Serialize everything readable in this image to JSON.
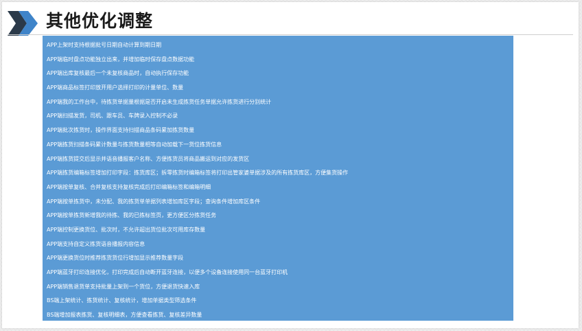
{
  "page": {
    "title": "其他优化调整"
  },
  "colors": {
    "content_background": "#5b9bd5",
    "header_chevron_dark": "#2b3a4a",
    "header_chevron_light": "#3f84c9"
  },
  "items": [
    "APP上架时支持根据批号日期自动计算到期日期",
    "APP端临时盘点功能独立出来，并增加临时保存盘点数据功能",
    "APP端出库复核最后一个未复核商品时，自动执行保存功能",
    "APP端商品标签打印放开用户选择打印的计量单位、数量",
    "APP端我的工作台中，待拣货单据量根据是否开启未生成拣货任务单据允许拣货进行分别统计",
    "APP端扫描发货，司机、跟车员、车牌录入控制不必录",
    "APP端批次拣货时，操作界面支持扫描商品条码累加拣货数量",
    "APP端拣货扫描条码累计数量与拣货数量相等自动加载下一货位拣货信息",
    "APP端拣货提交后显示并语音播报客户名称、方便拣货员将商品搬运到对应的发货区",
    "APP端拣货编箱标签增加打印字段：拣货库区；拆零拣货时编箱标签将打印出管家婆单据涉及的所有拣货库区，方便集货操作",
    "APP端按单复核、合并复核支持复核完成后打印编箱标签和编箱明细",
    "APP端按单拣货中，未分配、我的拣货单单据列表增加库区字段；查询条件增加库区条件",
    "APP端按单拣货新增我的待拣、我的已拣标签页，更方便区分拣货任务",
    "APP端控制更换货位、批次时，不允许超出货位批次可用库存数量",
    "APP端支持自定义拣货语音播报内容信息",
    "APP端更换货位时推荐拣货货位行增加显示推荐数量字段",
    "APP端蓝牙打印连接优化，打印完成后自动断开蓝牙连接，以便多个设备连接使用同一台蓝牙打印机",
    "APP端销售退货单支持批量上架到一个货位，方便退货快速入库",
    "BS端上架统计、拣货统计、复核统计，增加单据类型筛选条件",
    "BS端增加报表拣货、复核明细表，方便查看拣货、复核差异数量"
  ]
}
